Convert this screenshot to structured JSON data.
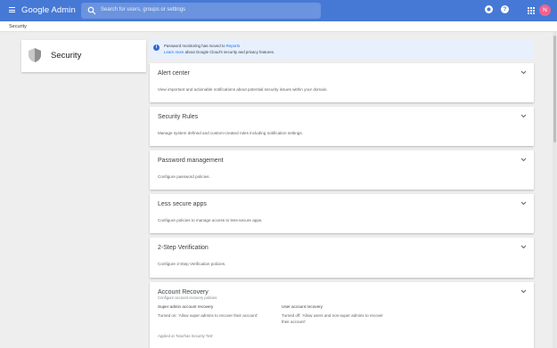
{
  "header": {
    "brand": "Google Admin",
    "search_placeholder": "Search for users, groups or settings",
    "help_icon_label": "?",
    "avatar_initial": "N",
    "colors": {
      "bar": "#4679d5",
      "avatar": "#f06292"
    }
  },
  "breadcrumb": {
    "label": "Security"
  },
  "left_panel": {
    "title": "Security",
    "icon": "shield-icon"
  },
  "notice": {
    "line1_prefix": "Password monitoring has moved to ",
    "line1_link": "Reports",
    "line2_link": "Learn more",
    "line2_suffix": " about Google Cloud's security and privacy features."
  },
  "sections": [
    {
      "title": "Alert center",
      "description": "View important and actionable notifications about potential security issues within your domain."
    },
    {
      "title": "Security Rules",
      "description": "Manage system defined and custom-created rules including notification settings."
    },
    {
      "title": "Password management",
      "description": "Configure password policies."
    },
    {
      "title": "Less secure apps",
      "description": "Configure policies to manage access to less-secure apps."
    },
    {
      "title": "2-Step Verification",
      "description": "Configure 2-Step Verification policies."
    }
  ],
  "recovery": {
    "title": "Account Recovery",
    "subtitle": "Configure account recovery policies",
    "col1_title": "Super admin account recovery",
    "col1_desc": "Turned on: 'Allow super admins to recover their account'",
    "col2_title": "User account recovery",
    "col2_desc_1": "Turned off: 'Allow users and non-super admins to recover",
    "col2_desc_2": "their account'",
    "applied": "Applied at 'Nourhas Security Test'"
  }
}
